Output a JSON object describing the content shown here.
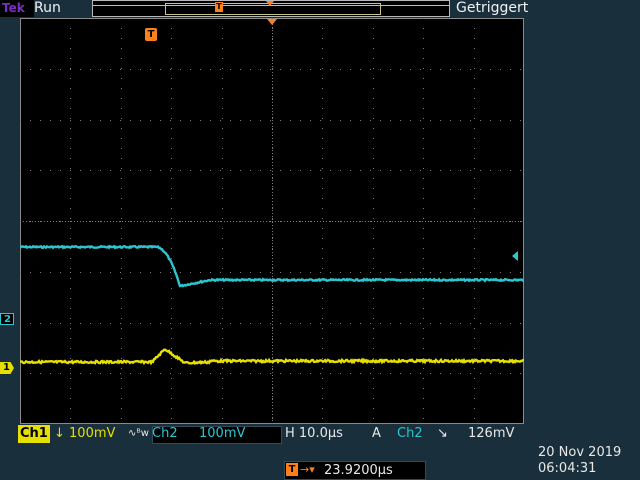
{
  "header": {
    "brand": "Tek",
    "run_state": "Run",
    "trigger_status": "Getriggert"
  },
  "markers": {
    "ch2": "2",
    "ch1": "1",
    "trigger_icon": "T"
  },
  "status": {
    "ch1_label": "Ch1",
    "ch1_scale": "↓ 100mV",
    "bw_symbol": "∿ᴮw",
    "ch2_label": "Ch2",
    "ch2_scale": "100mV",
    "horizontal_label": "H 10.0µs",
    "acquire_label": "A",
    "trigger_source": "Ch2",
    "trigger_slope": "↘",
    "trigger_level": "126mV",
    "trigger_position": "23.9200µs"
  },
  "datetime": {
    "date": "20 Nov 2019",
    "time": "06:04:31"
  },
  "colors": {
    "ch1": "#e5e000",
    "ch2": "#2bc6cf",
    "trigger": "#ff7f1a",
    "panel": "#1a2f3c"
  }
}
